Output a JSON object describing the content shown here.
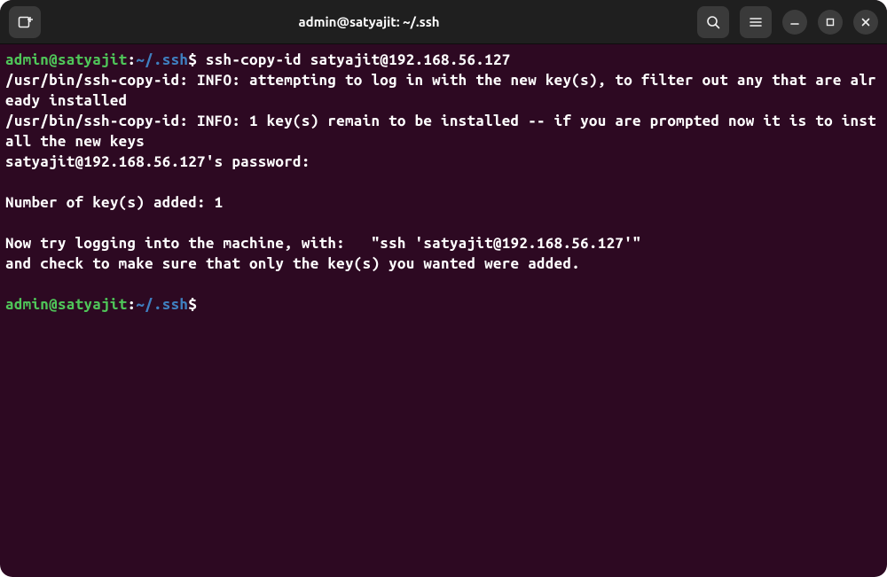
{
  "titlebar": {
    "title": "admin@satyajit: ~/.ssh"
  },
  "prompt1": {
    "user": "admin",
    "at": "@",
    "host": "satyajit",
    "colon": ":",
    "path": "~/.ssh",
    "dollar": "$ ",
    "command": "ssh-copy-id satyajit@192.168.56.127"
  },
  "output": {
    "line1": "/usr/bin/ssh-copy-id: INFO: attempting to log in with the new key(s), to filter out any that are already installed",
    "line2": "/usr/bin/ssh-copy-id: INFO: 1 key(s) remain to be installed -- if you are prompted now it is to install the new keys",
    "line3": "satyajit@192.168.56.127's password:",
    "blank1": "",
    "line4": "Number of key(s) added: 1",
    "blank2": "",
    "line5": "Now try logging into the machine, with:   \"ssh 'satyajit@192.168.56.127'\"",
    "line6": "and check to make sure that only the key(s) you wanted were added.",
    "blank3": ""
  },
  "prompt2": {
    "user": "admin",
    "at": "@",
    "host": "satyajit",
    "colon": ":",
    "path": "~/.ssh",
    "dollar": "$"
  }
}
